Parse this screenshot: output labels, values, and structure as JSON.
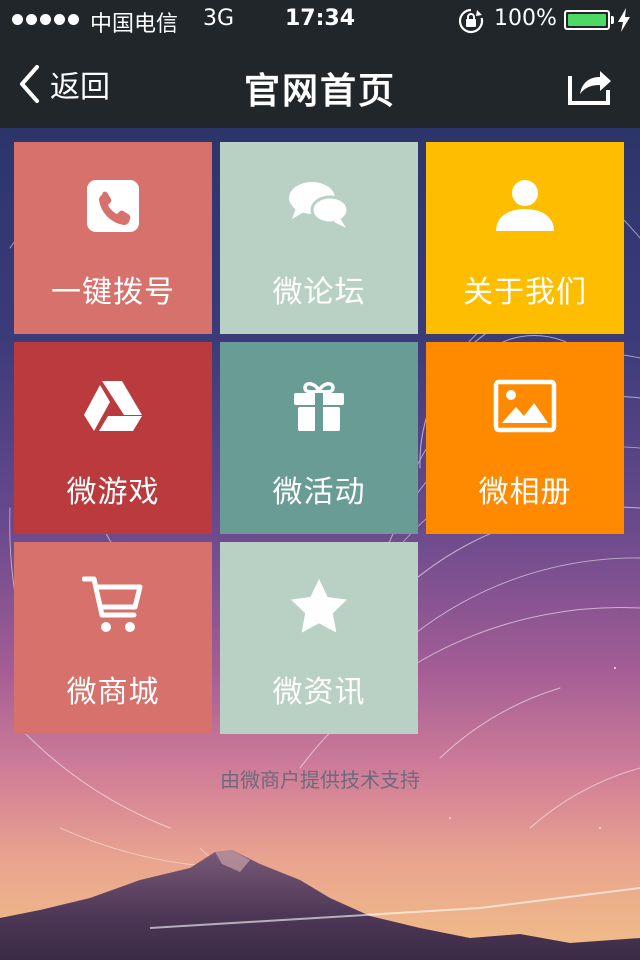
{
  "status_bar": {
    "carrier": "中国电信",
    "network": "3G",
    "time": "17:34",
    "battery": "100%",
    "battery_level": 1.0,
    "signal_bars": 5
  },
  "nav": {
    "back_label": "返回",
    "title": "官网首页"
  },
  "tiles": [
    {
      "label": "一键拨号",
      "icon": "phone-icon",
      "color": "#d6716c"
    },
    {
      "label": "微论坛",
      "icon": "chat-bubbles-icon",
      "color": "#b9d1c5"
    },
    {
      "label": "关于我们",
      "icon": "user-icon",
      "color": "#ffbd00"
    },
    {
      "label": "微游戏",
      "icon": "drive-triangle-icon",
      "color": "#ba3a3d"
    },
    {
      "label": "微活动",
      "icon": "gift-icon",
      "color": "#6a9c96"
    },
    {
      "label": "微相册",
      "icon": "picture-icon",
      "color": "#ff8a00"
    },
    {
      "label": "微商城",
      "icon": "cart-icon",
      "color": "#d6716c"
    },
    {
      "label": "微资讯",
      "icon": "star-icon",
      "color": "#b9d1c5"
    }
  ],
  "footer": "由微商户提供技术支持"
}
